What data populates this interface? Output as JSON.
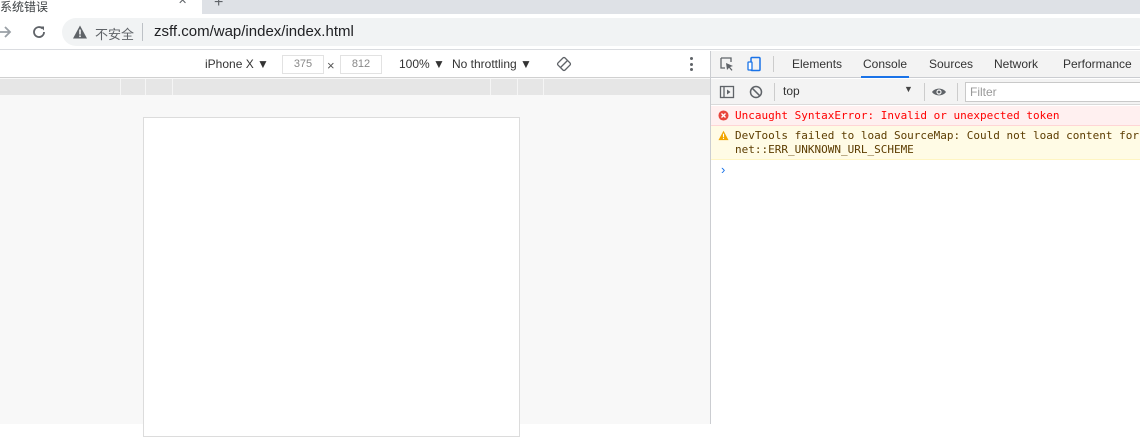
{
  "browser": {
    "tab": {
      "title": "系统错误",
      "close_glyph": "✕",
      "new_tab_glyph": "+"
    },
    "toolbar": {
      "back_glyph": "→",
      "reload_glyph": "C"
    },
    "omnibox": {
      "security_label": "不安全",
      "url": "zsff.com/wap/index/index.html"
    }
  },
  "device_toolbar": {
    "device": "iPhone X ▼",
    "width": "375",
    "height": "812",
    "times": "×",
    "zoom": "100% ▼",
    "throttling": "No throttling ▼"
  },
  "devtools": {
    "tabs": [
      {
        "label": "Elements",
        "active": false
      },
      {
        "label": "Console",
        "active": true
      },
      {
        "label": "Sources",
        "active": false
      },
      {
        "label": "Network",
        "active": false
      },
      {
        "label": "Performance",
        "active": false
      }
    ],
    "console_bar": {
      "context": "top",
      "filter_placeholder": "Filter"
    },
    "messages": [
      {
        "level": "error",
        "text": "Uncaught SyntaxError: Invalid or unexpected token"
      },
      {
        "level": "warning",
        "line1": "DevTools failed to load SourceMap: Could not load content for",
        "line2": "net::ERR_UNKNOWN_URL_SCHEME"
      }
    ],
    "prompt_glyph": "›"
  },
  "colors": {
    "accent": "#1a73e8",
    "error_text": "#ff0000",
    "error_bg": "#fff0f0",
    "warning_bg": "#fffbe5"
  }
}
